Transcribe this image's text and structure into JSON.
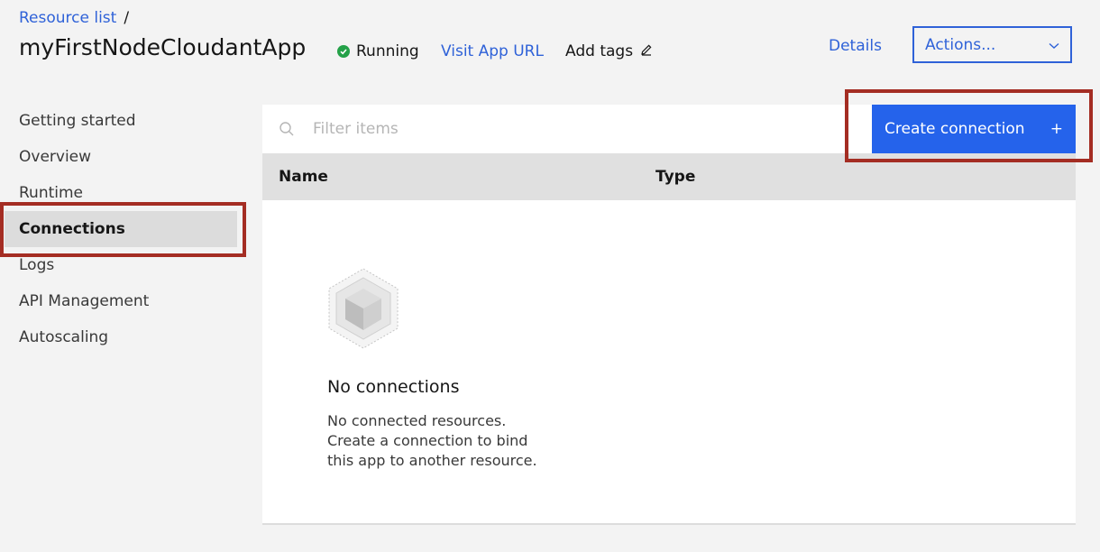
{
  "breadcrumb": {
    "link": "Resource list",
    "separator": "/"
  },
  "app": {
    "title": "myFirstNodeCloudantApp",
    "status": "Running",
    "visit_url": "Visit App URL",
    "add_tags": "Add tags"
  },
  "header": {
    "details": "Details",
    "actions": "Actions..."
  },
  "sidebar": {
    "items": [
      {
        "label": "Getting started"
      },
      {
        "label": "Overview"
      },
      {
        "label": "Runtime"
      },
      {
        "label": "Connections"
      },
      {
        "label": "Logs"
      },
      {
        "label": "API Management"
      },
      {
        "label": "Autoscaling"
      }
    ]
  },
  "connections": {
    "filter_placeholder": "Filter items",
    "create_button": "Create connection",
    "create_icon": "+",
    "columns": [
      "Name",
      "Type"
    ],
    "empty_title": "No connections",
    "empty_desc": "No connected resources.\nCreate a connection to bind\nthis app to another resource."
  },
  "colors": {
    "accent": "#2f62d8",
    "primary_button": "#2563eb",
    "status_ok": "#24a148",
    "highlight": "#a42d23"
  }
}
